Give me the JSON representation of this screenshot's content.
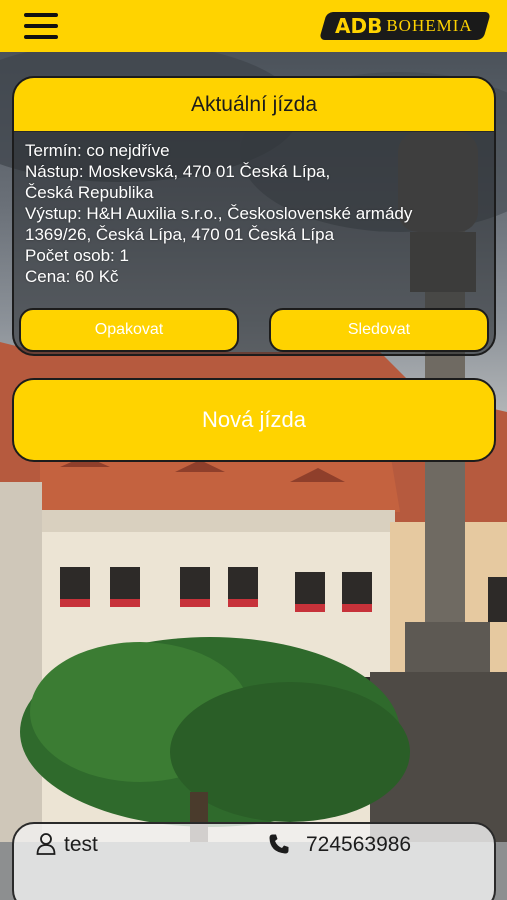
{
  "header": {
    "menu_icon": "hamburger-icon",
    "logo": {
      "mark": "ADB",
      "name": "BOHEMIA"
    }
  },
  "current_ride": {
    "title": "Aktuální jízda",
    "details": {
      "termin": "Termín: co nejdříve",
      "nastup": "Nástup: Moskevská, 470 01 Česká Lípa,\nČeská Republika",
      "vystup": "Výstup: H&H Auxilia s.r.o., Československé armády\n1369/26, Česká Lípa, 470 01 Česká Lípa",
      "pocet_osob": "Počet osob: 1",
      "cena": "Cena: 60 Kč"
    },
    "buttons": {
      "repeat": "Opakovat",
      "track": "Sledovat"
    }
  },
  "new_ride": {
    "label": "Nová jízda"
  },
  "user_bar": {
    "user_icon": "user-icon",
    "username": "test",
    "phone_icon": "phone-icon",
    "phone": "724563986"
  },
  "colors": {
    "accent": "#ffd300",
    "dark": "#1c1c1c",
    "text_on_accent": "#ffffff"
  }
}
